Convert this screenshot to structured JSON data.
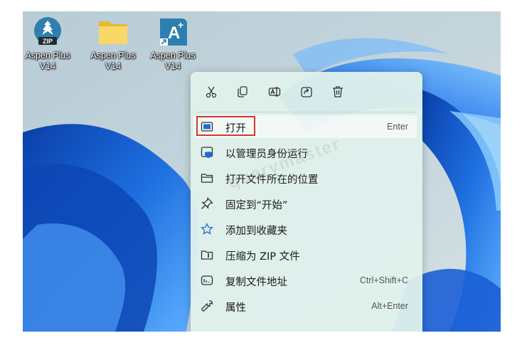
{
  "desktop": {
    "icons": [
      {
        "label_line1": "Aspen Plus",
        "label_line2": "V14",
        "icon": "zip-archive-icon"
      },
      {
        "label_line1": "Aspen Plus",
        "label_line2": "V14",
        "icon": "folder-icon"
      },
      {
        "label_line1": "Aspen Plus",
        "label_line2": "V14",
        "icon": "aspen-plus-app-icon"
      }
    ]
  },
  "context_menu": {
    "toolbar": [
      {
        "icon": "cut-icon",
        "label": "Cut"
      },
      {
        "icon": "copy-icon",
        "label": "Copy"
      },
      {
        "icon": "rename-icon",
        "label": "Rename"
      },
      {
        "icon": "share-icon",
        "label": "Share"
      },
      {
        "icon": "delete-icon",
        "label": "Delete"
      }
    ],
    "items": [
      {
        "label": "打开",
        "shortcut": "Enter",
        "icon": "open-window-icon"
      },
      {
        "label": "以管理员身份运行",
        "shortcut": "",
        "icon": "admin-shield-icon"
      },
      {
        "label": "打开文件所在的位置",
        "shortcut": "",
        "icon": "folder-outline-icon"
      },
      {
        "label": "固定到“开始”",
        "shortcut": "",
        "icon": "pin-icon"
      },
      {
        "label": "添加到收藏夹",
        "shortcut": "",
        "icon": "star-icon"
      },
      {
        "label": "压缩为 ZIP 文件",
        "shortcut": "",
        "icon": "zip-compress-icon"
      },
      {
        "label": "复制文件地址",
        "shortcut": "Ctrl+Shift+C",
        "icon": "copy-path-icon"
      },
      {
        "label": "属性",
        "shortcut": "Alt+Enter",
        "icon": "wrench-icon"
      }
    ]
  },
  "watermark": "querymaster",
  "colors": {
    "highlight_box": "#d03a2f",
    "menu_background": "#e0f1ec",
    "shield_blue": "#1f6fd1",
    "app_icon_bg": "#2d7fb0"
  }
}
